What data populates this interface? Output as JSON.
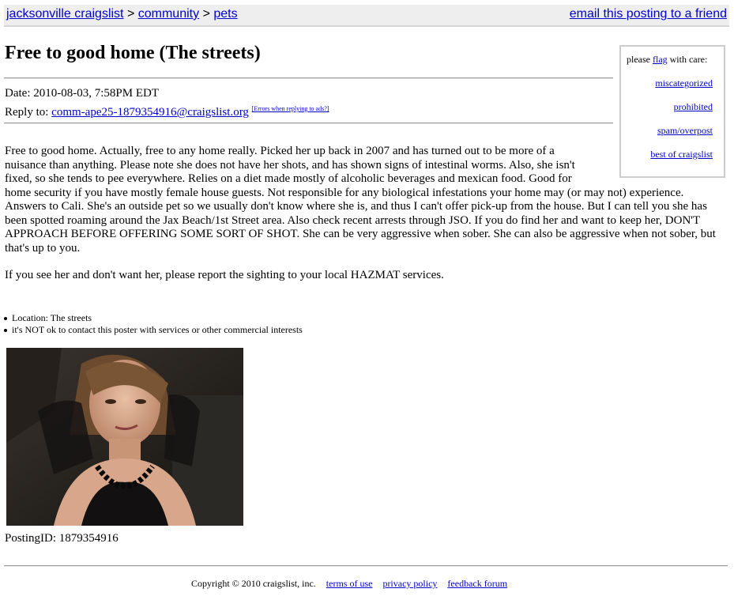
{
  "nav": {
    "crumbs": [
      "jacksonville craigslist",
      "community",
      "pets"
    ],
    "separator": ">",
    "email_link": "email this posting to a friend"
  },
  "posting": {
    "title": "Free to good home (The streets)",
    "date_label": "Date:",
    "date_value": "2010-08-03, 7:58PM EDT",
    "reply_label": "Reply to:",
    "reply_email": "comm-ape25-1879354916@craigslist.org",
    "errors_link": "[Errors when replying to ads?]",
    "body_line1": "Free to good home. Actually, free to any home really. Picked her up back in 2007 and has turned out to be more of a",
    "body_line2": "nuisance than anything. Please note she does not have her shots, and has shown signs of intestinal worms. Also, she isn't",
    "body_line3": "fixed, so she tends to pee everywhere. Relies on a diet made mostly of alcoholic beverages and mexican food. Good for",
    "body_rest": "home security if you have mostly female house guests. Not responsible for any biological infestations your home may (or may not) experience. Answers to Cali. She's an outside pet so we usually don't know where she is, and thus I can't offer pick-up from the house. But I can tell you she has been spotted roaming around the Jax Beach/1st Street area. Also check recent arrests through JSO. If you do find her and want to keep her, DON'T APPROACH BEFORE OFFERING SOME SORT OF SHOT. She can be very aggressive when sober. She can also be aggressive when not sober, but that's up to you.",
    "body_para2": "If you see her and don't want her, please report the sighting to your local HAZMAT services.",
    "info_items": [
      "Location: The streets",
      "it's NOT ok to contact this poster with services or other commercial interests"
    ],
    "posting_id": "PostingID: 1879354916"
  },
  "flagbox": {
    "prefix": "please ",
    "flag_link": "flag",
    "suffix": " with care:",
    "links": [
      "miscategorized",
      "prohibited",
      "spam/overpost",
      "best of craigslist"
    ]
  },
  "footer": {
    "copyright": "Copyright © 2010 craigslist, inc.",
    "links": [
      "terms of use",
      "privacy policy",
      "feedback forum"
    ]
  },
  "colors": {
    "link": "#0000cc",
    "bar": "#eeeeee"
  }
}
